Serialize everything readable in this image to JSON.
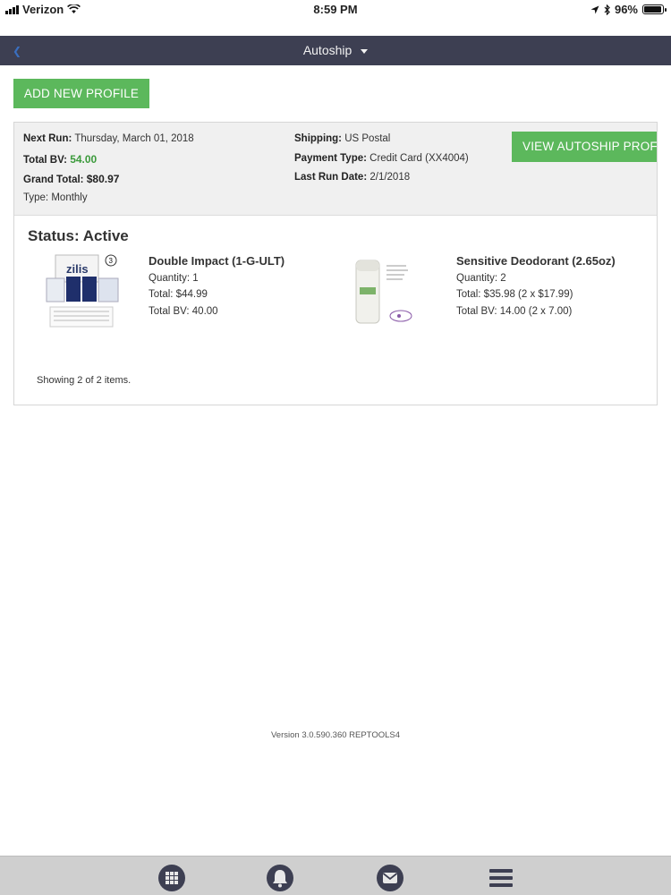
{
  "status_bar": {
    "carrier": "Verizon",
    "time": "8:59 PM",
    "battery": "96%",
    "battery_level": 0.96
  },
  "nav": {
    "title": "Autoship"
  },
  "actions": {
    "add_new_profile": "ADD NEW PROFILE",
    "view_autoship_profile": "VIEW AUTOSHIP PROF"
  },
  "profile": {
    "next_run_label": "Next Run:",
    "next_run": "Thursday, March 01, 2018",
    "total_bv_label": "Total BV:",
    "total_bv": "54.00",
    "grand_total_label": "Grand Total:",
    "grand_total": "$80.97",
    "type_label": "Type:",
    "type": "Monthly",
    "shipping_label": "Shipping:",
    "shipping": "US Postal",
    "payment_type_label": "Payment Type:",
    "payment_type": "Credit Card (XX4004)",
    "last_run_date_label": "Last Run Date:",
    "last_run_date": "2/1/2018",
    "status": "Status: Active"
  },
  "items": [
    {
      "name": "Double Impact (1-G-ULT)",
      "quantity": "Quantity: 1",
      "total": "Total: $44.99",
      "total_bv": "Total BV: 40.00",
      "image_icon": "product-box-image",
      "image_text": "zilis"
    },
    {
      "name": "Sensitive Deodorant (2.65oz)",
      "quantity": "Quantity: 2",
      "total": "Total: $35.98 (2 x $17.99)",
      "total_bv": "Total BV: 14.00 (2 x 7.00)",
      "image_icon": "deodorant-image"
    }
  ],
  "list_footer": {
    "showing": "Showing 2 of 2 items."
  },
  "footer": {
    "version": "Version 3.0.590.360 REPTOOLS4"
  },
  "tab_bar": {
    "icons": [
      "grid-icon",
      "bell-icon",
      "mail-icon",
      "menu-icon"
    ]
  },
  "colors": {
    "nav_bg": "#3d3f52",
    "accent_green": "#5cb85c",
    "bv_green": "#3b9a3b",
    "tab_bar_bg": "#cfcfcf"
  }
}
